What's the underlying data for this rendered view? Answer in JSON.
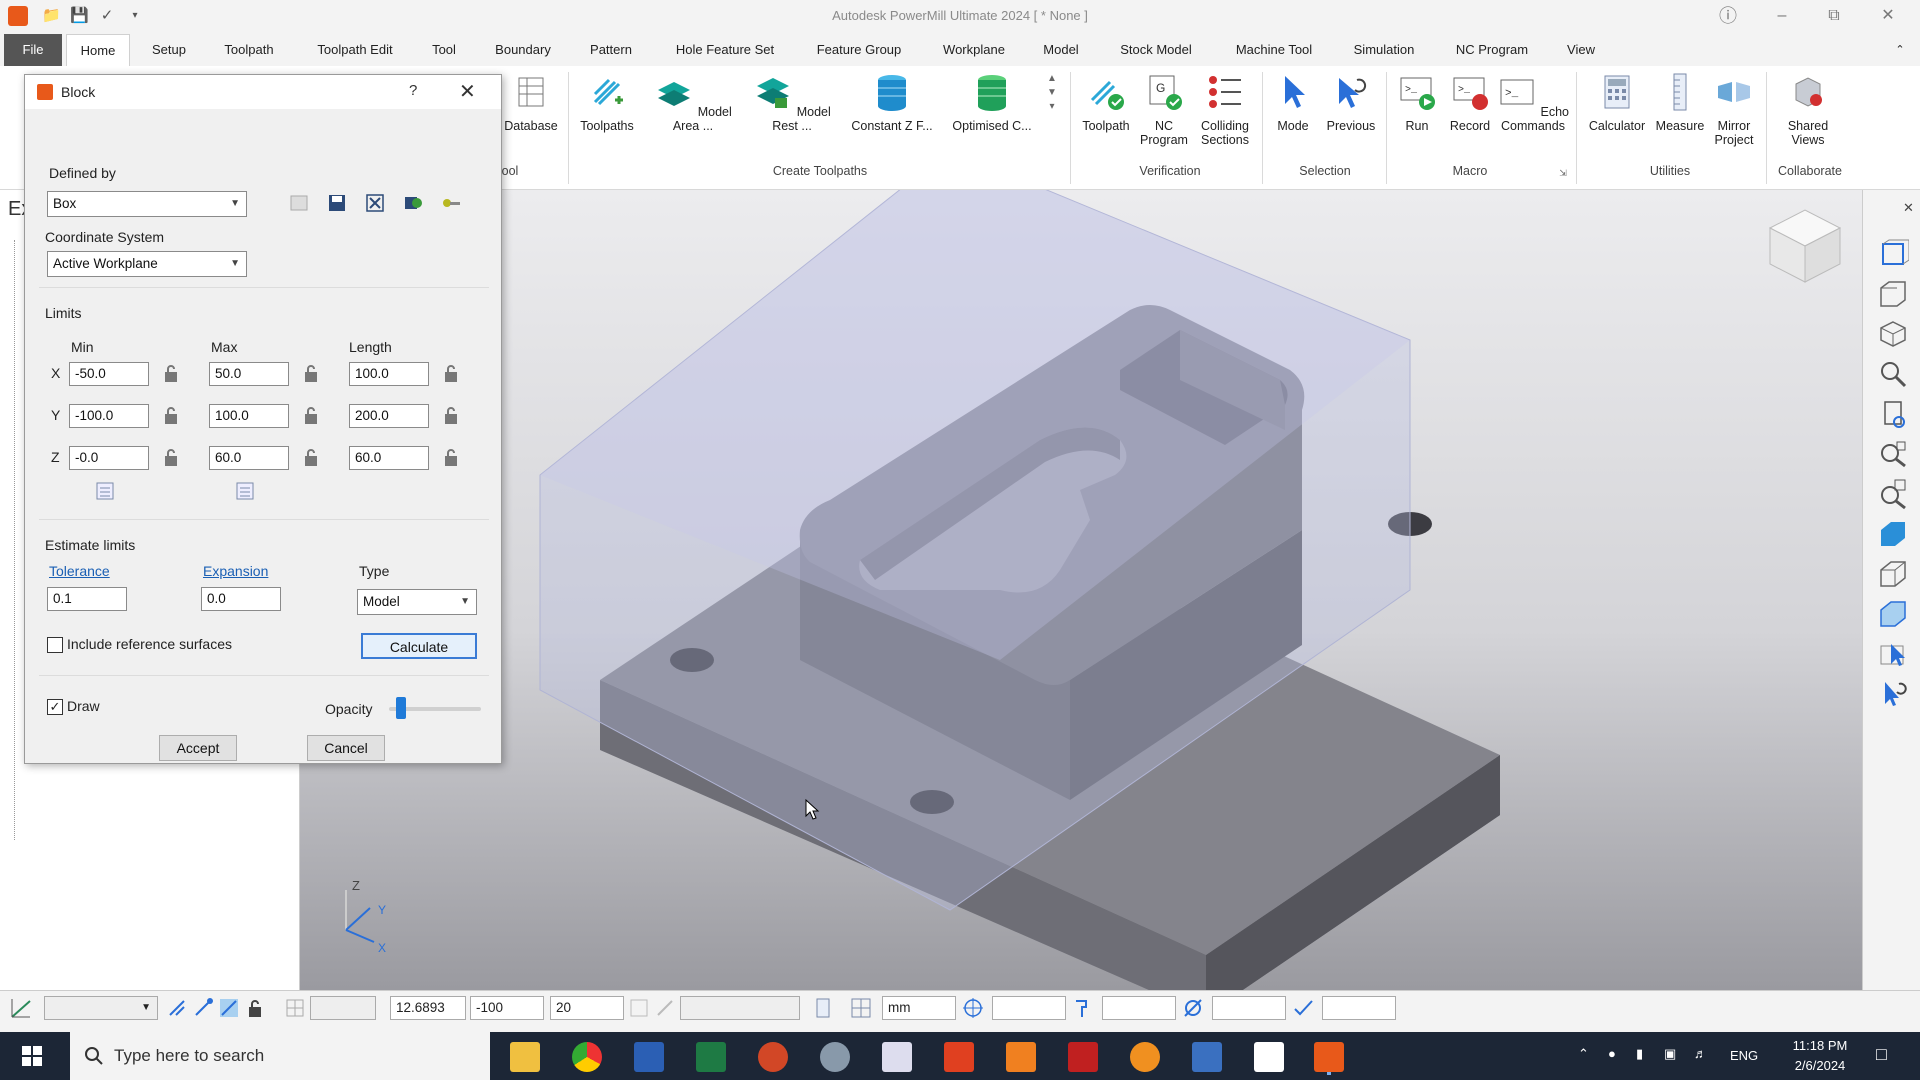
{
  "window": {
    "title": "Autodesk PowerMill Ultimate 2024   [ * None ]"
  },
  "tabs": [
    {
      "label": "File"
    },
    {
      "label": "Home"
    },
    {
      "label": "Setup"
    },
    {
      "label": "Toolpath"
    },
    {
      "label": "Toolpath Edit"
    },
    {
      "label": "Tool"
    },
    {
      "label": "Boundary"
    },
    {
      "label": "Pattern"
    },
    {
      "label": "Hole Feature Set"
    },
    {
      "label": "Feature Group"
    },
    {
      "label": "Workplane"
    },
    {
      "label": "Model"
    },
    {
      "label": "Stock Model"
    },
    {
      "label": "Machine Tool"
    },
    {
      "label": "Simulation"
    },
    {
      "label": "NC Program"
    },
    {
      "label": "View"
    }
  ],
  "ribbon": {
    "tool_group_fragment": "ool",
    "database": "Database",
    "toolpaths": "Toolpaths",
    "model_area": "Model Area ...",
    "model_rest": "Model Rest ...",
    "constant_z": "Constant Z F...",
    "optimised": "Optimised C...",
    "create_toolpaths": "Create Toolpaths",
    "toolpath_verify": "Toolpath",
    "nc_program_1": "NC",
    "nc_program_2": "Program",
    "colliding_1": "Colliding",
    "colliding_2": "Sections",
    "verification": "Verification",
    "mode": "Mode",
    "previous": "Previous",
    "selection": "Selection",
    "run": "Run",
    "record": "Record",
    "echo_1": "Echo",
    "echo_2": "Commands",
    "macro": "Macro",
    "calculator": "Calculator",
    "measure": "Measure",
    "mirror_1": "Mirror",
    "mirror_2": "Project",
    "utilities": "Utilities",
    "shared_1": "Shared",
    "shared_2": "Views",
    "collaborate": "Collaborate"
  },
  "leftpanel": {
    "fragment": "Ex"
  },
  "dialog": {
    "title": "Block",
    "help": "?",
    "defined_by_label": "Defined by",
    "defined_by_value": "Box",
    "coord_label": "Coordinate System",
    "coord_value": "Active Workplane",
    "limits_label": "Limits",
    "col_min": "Min",
    "col_max": "Max",
    "col_length": "Length",
    "rows": [
      {
        "axis": "X",
        "min": "-50.0",
        "max": "50.0",
        "length": "100.0"
      },
      {
        "axis": "Y",
        "min": "-100.0",
        "max": "100.0",
        "length": "200.0"
      },
      {
        "axis": "Z",
        "min": "-0.0",
        "max": "60.0",
        "length": "60.0"
      }
    ],
    "estimate_label": "Estimate limits",
    "tolerance_label": "Tolerance",
    "tolerance_value": "0.1",
    "expansion_label": "Expansion",
    "expansion_value": "0.0",
    "type_label": "Type",
    "type_value": "Model",
    "include_ref": "Include reference surfaces",
    "include_ref_checked": false,
    "calculate": "Calculate",
    "draw": "Draw",
    "draw_checked": true,
    "opacity_label": "Opacity",
    "opacity_level": 0.08,
    "accept": "Accept",
    "cancel": "Cancel"
  },
  "axis_triad": {
    "z": "Z",
    "y": "Y",
    "x": "X"
  },
  "status": {
    "x": "12.6893",
    "y": "-100",
    "z": "20",
    "units": "mm"
  },
  "taskbar": {
    "search_placeholder": "Type here to search",
    "lang": "ENG",
    "time": "11:18 PM",
    "date": "2/6/2024"
  }
}
